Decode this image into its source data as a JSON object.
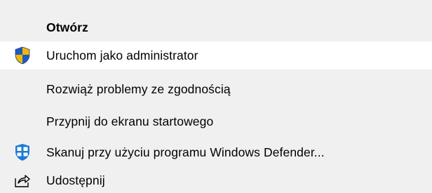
{
  "context_menu": {
    "items": [
      {
        "label": "Otwórz",
        "icon": "",
        "bold": true
      },
      {
        "label": "Uruchom jako administrator",
        "icon": "uac-shield-icon",
        "bold": false
      },
      {
        "label": "Rozwiąż problemy ze zgodnością",
        "icon": "",
        "bold": false
      },
      {
        "label": "Przypnij do ekranu startowego",
        "icon": "",
        "bold": false
      },
      {
        "label": "Skanuj przy użyciu programu Windows Defender...",
        "icon": "windows-defender-icon",
        "bold": false
      },
      {
        "label": "Udostępnij",
        "icon": "share-icon",
        "bold": false
      }
    ]
  },
  "colors": {
    "menu_background": "#f0f0f0",
    "highlight_background": "#ffffff",
    "shield_blue": "#1e5bbf",
    "shield_yellow": "#f2b705",
    "defender_blue": "#1a7bd8"
  }
}
